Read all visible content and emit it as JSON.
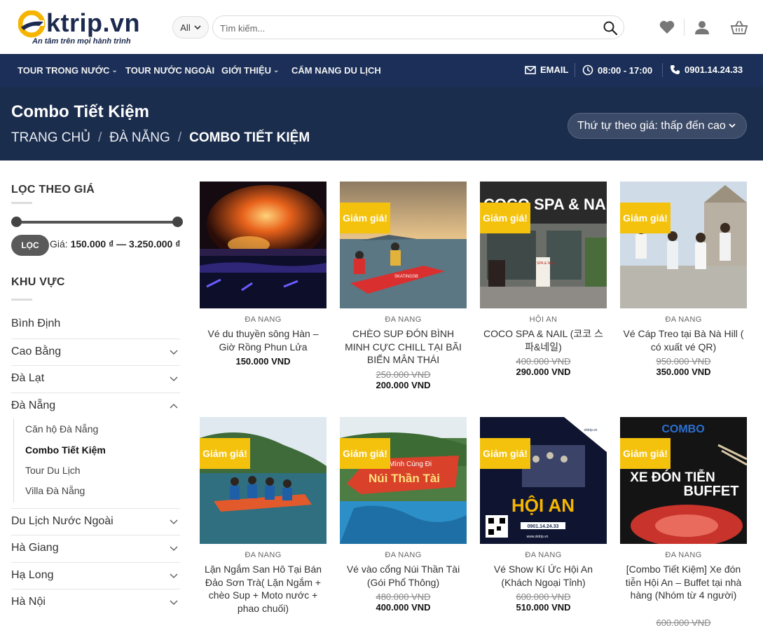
{
  "header": {
    "logo_text": "ktrip.vn",
    "tagline": "An tâm trên mọi hành trình",
    "category_select": "All",
    "search_placeholder": "Tìm kiếm..."
  },
  "nav": {
    "items": [
      {
        "label": "TOUR TRONG NƯỚC",
        "has_dropdown": true
      },
      {
        "label": "TOUR NƯỚC NGOÀI",
        "has_dropdown": false
      },
      {
        "label": "GIỚI THIỆU",
        "has_dropdown": true
      },
      {
        "label": "CẨM NANG DU LỊCH",
        "has_dropdown": false
      }
    ],
    "email": "EMAIL",
    "hours": "08:00 - 17:00",
    "phone": "0901.14.24.33"
  },
  "page": {
    "title": "Combo Tiết Kiệm",
    "breadcrumb": [
      "TRANG CHỦ",
      "/",
      "ĐÀ NẴNG",
      "/",
      "COMBO TIẾT KIỆM"
    ],
    "orderby": "Thứ tự theo giá: thấp đến cao"
  },
  "sidebar": {
    "price_filter_title": "LỌC THEO GIÁ",
    "filter_button": "LỌC",
    "price_prefix": "Giá:",
    "price_range": "150.000 ₫ — 3.250.000 ₫",
    "area_title": "KHU VỰC",
    "categories": [
      {
        "label": "Bình Định",
        "expandable": false
      },
      {
        "label": "Cao Bằng",
        "expandable": true
      },
      {
        "label": "Đà Lạt",
        "expandable": true
      },
      {
        "label": "Đà Nẵng",
        "expandable": true,
        "expanded": true
      },
      {
        "label": "Du Lịch Nước Ngoài",
        "expandable": true
      },
      {
        "label": "Hà Giang",
        "expandable": true
      },
      {
        "label": "Hạ Long",
        "expandable": true
      },
      {
        "label": "Hà Nội",
        "expandable": true
      }
    ],
    "subcategories": [
      {
        "label": "Căn hộ Đà Nẵng",
        "active": false
      },
      {
        "label": "Combo Tiết Kiệm",
        "active": true
      },
      {
        "label": "Tour Du Lịch",
        "active": false
      },
      {
        "label": "Villa Đà Nẵng",
        "active": false
      }
    ]
  },
  "sale_badge": "Giảm giá!",
  "products": [
    {
      "category": "ĐA NANG",
      "name": "Vé du thuyền sông Hàn – Giờ Rồng Phun Lửa",
      "old_price": "",
      "price": "150.000 VND",
      "sale": false
    },
    {
      "category": "ĐA NANG",
      "name": "CHÈO SUP ĐÓN BÌNH MINH CỰC CHILL TẠI BÃI BIỂN MÂN THÁI",
      "old_price": "250.000 VND",
      "price": "200.000 VND",
      "sale": true
    },
    {
      "category": "HỘI AN",
      "name": "COCO SPA & NAIL (코코 스파&네일)",
      "old_price": "400.000 VND",
      "price": "290.000 VND",
      "sale": true
    },
    {
      "category": "ĐA NANG",
      "name": "Vé Cáp Treo tại Bà Nà Hill ( có xuất vé QR)",
      "old_price": "950.000 VND",
      "price": "350.000 VND",
      "sale": true
    },
    {
      "category": "ĐA NANG",
      "name": "Lặn Ngắm San Hô Tại Bán Đảo Sơn Trà( Lặn Ngắm + chèo Sup + Moto nước + phao chuối)",
      "old_price": "",
      "price": "",
      "sale": true
    },
    {
      "category": "ĐA NANG",
      "name": "Vé vào cổng Núi Thần Tài (Gói Phổ Thông)",
      "old_price": "480.000 VND",
      "price": "400.000 VND",
      "sale": true
    },
    {
      "category": "ĐA NANG",
      "name": "Vé Show Kí Ức Hội An (Khách Ngoại Tỉnh)",
      "old_price": "600.000 VND",
      "price": "510.000 VND",
      "sale": true
    },
    {
      "category": "ĐA NANG",
      "name": "[Combo Tiết Kiệm] Xe đón tiễn Hội An – Buffet tại nhà hàng (Nhóm từ 4 người)",
      "old_price": "600.000 VND",
      "price": "",
      "sale": true
    }
  ],
  "image_text": {
    "spa_sign": "COCO SPA & NAIL",
    "spa_board": "SPA & NAIL",
    "kayak": "SKATINGSB",
    "than_tai_line1": "Nào Mình Cùng Đi",
    "than_tai_line2": "Núi Thần Tài",
    "hoi_an_brand": "oktrip.vn",
    "hoi_an_title": "HỘI AN",
    "hoi_an_phone": "0901.14.24.33",
    "hoi_an_web": "www.oktrip.vn",
    "combo_top": "COMBO",
    "combo_line1": "XE ĐÓN TIỄN",
    "combo_line2": "BUFFET"
  }
}
